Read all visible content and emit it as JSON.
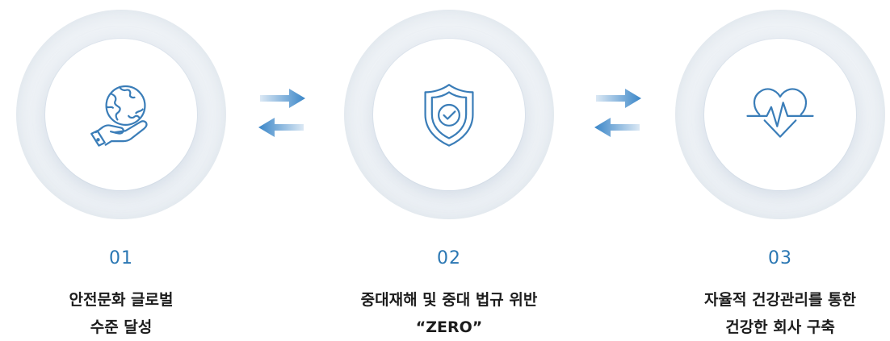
{
  "colors": {
    "accent": "#2a77b3",
    "icon_stroke": "#3a7db8",
    "arrow_dark": "#3a86c8",
    "arrow_light": "#dbe8f4",
    "title_text": "#1c1c1c"
  },
  "steps": [
    {
      "number": "01",
      "icon": "globe-in-hand-icon",
      "title_line1": "안전문화 글로벌",
      "title_line2": "수준 달성"
    },
    {
      "number": "02",
      "icon": "shield-check-icon",
      "title_line1": "중대재해 및 중대 법규 위반",
      "title_line2": "“ZERO”"
    },
    {
      "number": "03",
      "icon": "heart-pulse-icon",
      "title_line1": "자율적 건강관리를 통한",
      "title_line2": "건강한 회사 구축"
    }
  ],
  "connectors": [
    {
      "icon": "bidirectional-arrows-icon"
    },
    {
      "icon": "bidirectional-arrows-icon"
    }
  ]
}
